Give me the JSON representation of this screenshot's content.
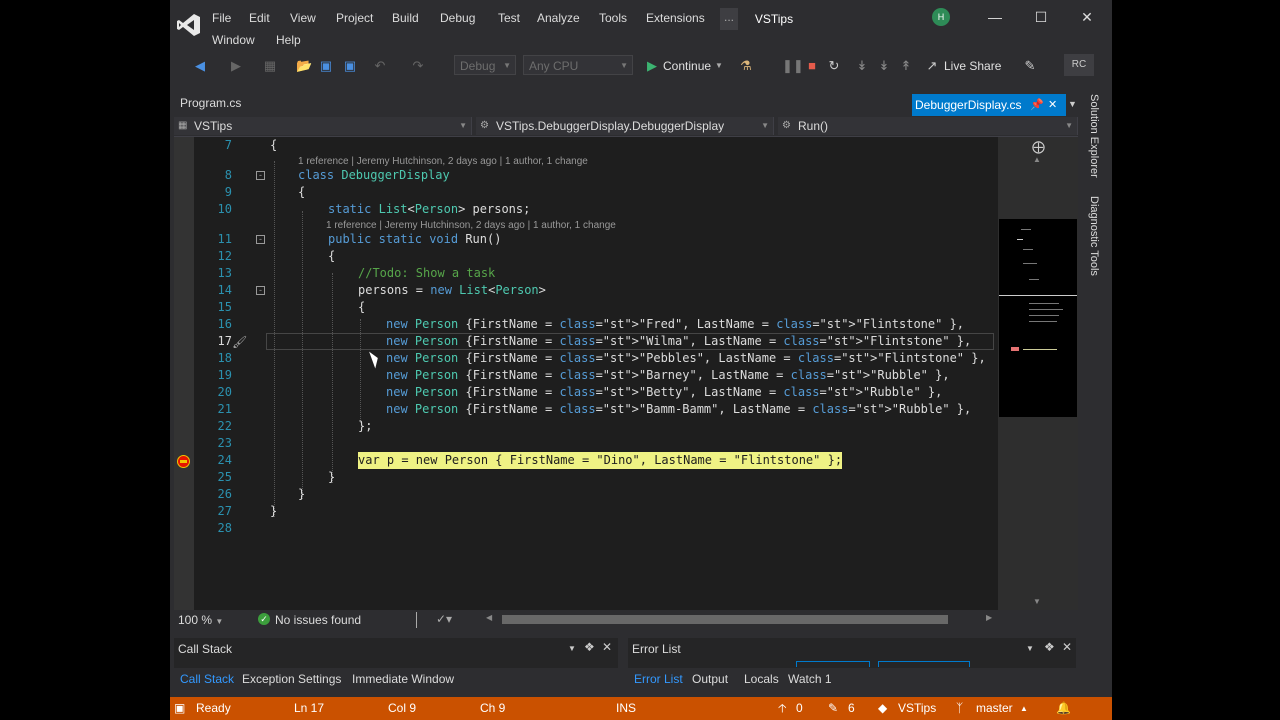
{
  "title": "VSTips",
  "menu": [
    "File",
    "Edit",
    "View",
    "Project",
    "Build",
    "Debug",
    "Test",
    "Analyze",
    "Tools",
    "Extensions",
    "Window",
    "Help"
  ],
  "menu_overflow": "...",
  "account_initial": "H",
  "toolbar": {
    "config": "Debug",
    "platform": "Any CPU",
    "continue_label": "Continue",
    "live_share_label": "Live Share",
    "user_badge": "RC"
  },
  "tabs": {
    "left": "Program.cs",
    "active": "DebuggerDisplay.cs"
  },
  "nav": {
    "project": "VSTips",
    "type": "VSTips.DebuggerDisplay.DebuggerDisplay",
    "member": "Run()"
  },
  "side_tabs": [
    "Solution Explorer",
    "Diagnostic Tools"
  ],
  "code": {
    "lens1": "1 reference | Jeremy Hutchinson, 2 days ago | 1 author, 1 change",
    "lens2": "1 reference | Jeremy Hutchinson, 2 days ago | 1 author, 1 change",
    "lines": [
      {
        "n": "7",
        "text": "{"
      },
      {
        "n": "8",
        "text": "class DebuggerDisplay"
      },
      {
        "n": "9",
        "text": "{"
      },
      {
        "n": "10",
        "text": "static List<Person> persons;"
      },
      {
        "n": "11",
        "text": "public static void Run()"
      },
      {
        "n": "12",
        "text": "{"
      },
      {
        "n": "13",
        "text": "//Todo: Show a task"
      },
      {
        "n": "14",
        "text": "persons = new List<Person>"
      },
      {
        "n": "15",
        "text": "{"
      },
      {
        "n": "16",
        "text": "new Person {FirstName = \"Fred\", LastName = \"Flintstone\" },"
      },
      {
        "n": "17",
        "text": "new Person {FirstName = \"Wilma\", LastName = \"Flintstone\" },"
      },
      {
        "n": "18",
        "text": "new Person {FirstName = \"Pebbles\", LastName = \"Flintstone\" },"
      },
      {
        "n": "19",
        "text": "new Person {FirstName = \"Barney\", LastName = \"Rubble\" },"
      },
      {
        "n": "20",
        "text": "new Person {FirstName = \"Betty\", LastName = \"Rubble\" },"
      },
      {
        "n": "21",
        "text": "new Person {FirstName = \"Bamm-Bamm\", LastName = \"Rubble\" },"
      },
      {
        "n": "22",
        "text": "};"
      },
      {
        "n": "23",
        "text": ""
      },
      {
        "n": "24",
        "text": "var p = new Person { FirstName = \"Dino\", LastName = \"Flintstone\" };"
      },
      {
        "n": "25",
        "text": "}"
      },
      {
        "n": "26",
        "text": "}"
      },
      {
        "n": "27",
        "text": "}"
      },
      {
        "n": "28",
        "text": ""
      }
    ]
  },
  "editor_bar": {
    "zoom": "100 %",
    "issues": "No issues found"
  },
  "panels": {
    "left_title": "Call Stack",
    "right_title": "Error List",
    "left_tabs": [
      "Call Stack",
      "Exception Settings",
      "Immediate Window"
    ],
    "right_tabs": [
      "Error List",
      "Output",
      "Locals",
      "Watch 1"
    ]
  },
  "status": {
    "ready": "Ready",
    "ln": "Ln 17",
    "col": "Col 9",
    "ch": "Ch 9",
    "ins": "INS",
    "up_count": "0",
    "edit_count": "6",
    "repo": "VSTips",
    "branch": "master"
  },
  "colors": {
    "accent": "#007acc",
    "status": "#ca5100",
    "highlight": "#eff284"
  }
}
